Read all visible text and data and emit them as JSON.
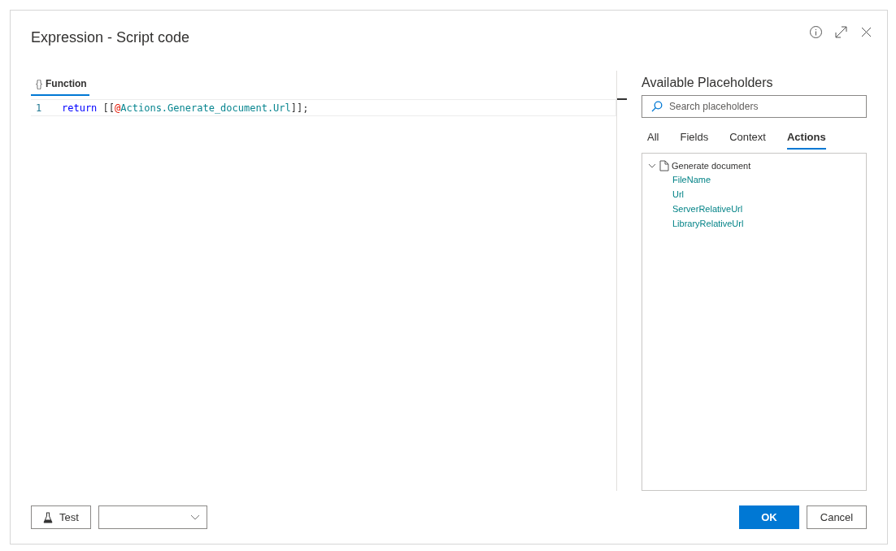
{
  "dialog": {
    "title": "Expression - Script code"
  },
  "editor": {
    "tabs": [
      {
        "label": "Function",
        "icon": "{}",
        "selected": true
      }
    ],
    "lines": [
      {
        "number": "1",
        "tokens": [
          {
            "kind": "keyword",
            "text": "return"
          },
          {
            "kind": "plain",
            "text": " [["
          },
          {
            "kind": "at",
            "text": "@"
          },
          {
            "kind": "ident",
            "text": "Actions.Generate_document.Url"
          },
          {
            "kind": "plain",
            "text": "]];"
          }
        ]
      }
    ]
  },
  "placeholders": {
    "title": "Available Placeholders",
    "search": {
      "placeholder": "Search placeholders"
    },
    "tabs": [
      {
        "label": "All",
        "selected": false
      },
      {
        "label": "Fields",
        "selected": false
      },
      {
        "label": "Context",
        "selected": false
      },
      {
        "label": "Actions",
        "selected": true
      }
    ],
    "tree": [
      {
        "label": "Generate document",
        "expanded": true,
        "children": [
          {
            "label": "FileName"
          },
          {
            "label": "Url"
          },
          {
            "label": "ServerRelativeUrl"
          },
          {
            "label": "LibraryRelativeUrl"
          }
        ]
      }
    ]
  },
  "footer": {
    "test_button": "Test",
    "ok_button": "OK",
    "cancel_button": "Cancel"
  }
}
